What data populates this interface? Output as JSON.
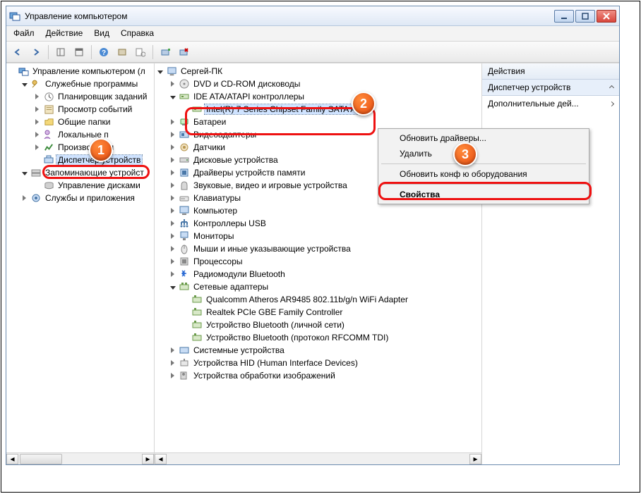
{
  "window": {
    "title": "Управление компьютером"
  },
  "menubar": [
    "Файл",
    "Действие",
    "Вид",
    "Справка"
  ],
  "left_tree": {
    "root": "Управление компьютером (л",
    "tools": {
      "label": "Служебные программы",
      "items": [
        "Планировщик заданий",
        "Просмотр событий",
        "Общие папки",
        "Локальные п",
        "Производител",
        "Диспетчер устройств"
      ]
    },
    "storage": {
      "label": "Запоминающие устройст",
      "items": [
        "Управление дисками"
      ]
    },
    "services": {
      "label": "Службы и приложения"
    }
  },
  "mid_tree": {
    "root": "Сергей-ПК",
    "items": [
      "DVD и CD-ROM дисководы",
      "IDE ATA/ATAPI контроллеры",
      "Батареи",
      "Видеоадаптеры",
      "Датчики",
      "Дисковые устройства",
      "Драйверы устройств памяти",
      "Звуковые, видео и игровые устройства",
      "Клавиатуры",
      "Компьютер",
      "Контроллеры USB",
      "Мониторы",
      "Мыши и иные указывающие устройства",
      "Процессоры",
      "Радиомодули Bluetooth",
      "Сетевые адаптеры",
      "Системные устройства",
      "Устройства HID (Human Interface Devices)",
      "Устройства обработки изображений"
    ],
    "ide_child": "Intel(R) 7 Series Chipset Family SATA A",
    "net_children": [
      "Qualcomm Atheros AR9485 802.11b/g/n WiFi Adapter",
      "Realtek PCIe GBE Family Controller",
      "Устройство Bluetooth (личной сети)",
      "Устройство Bluetooth (протокол RFCOMM TDI)"
    ]
  },
  "context_menu": {
    "items": [
      "Обновить драйверы...",
      "Удалить",
      "Обновить конф             ю оборудования",
      "Свойства"
    ]
  },
  "right": {
    "header": "Действия",
    "selected": "Диспетчер устройств",
    "action": "Дополнительные дей..."
  },
  "callouts": {
    "c1": "1",
    "c2": "2",
    "c3": "3"
  }
}
